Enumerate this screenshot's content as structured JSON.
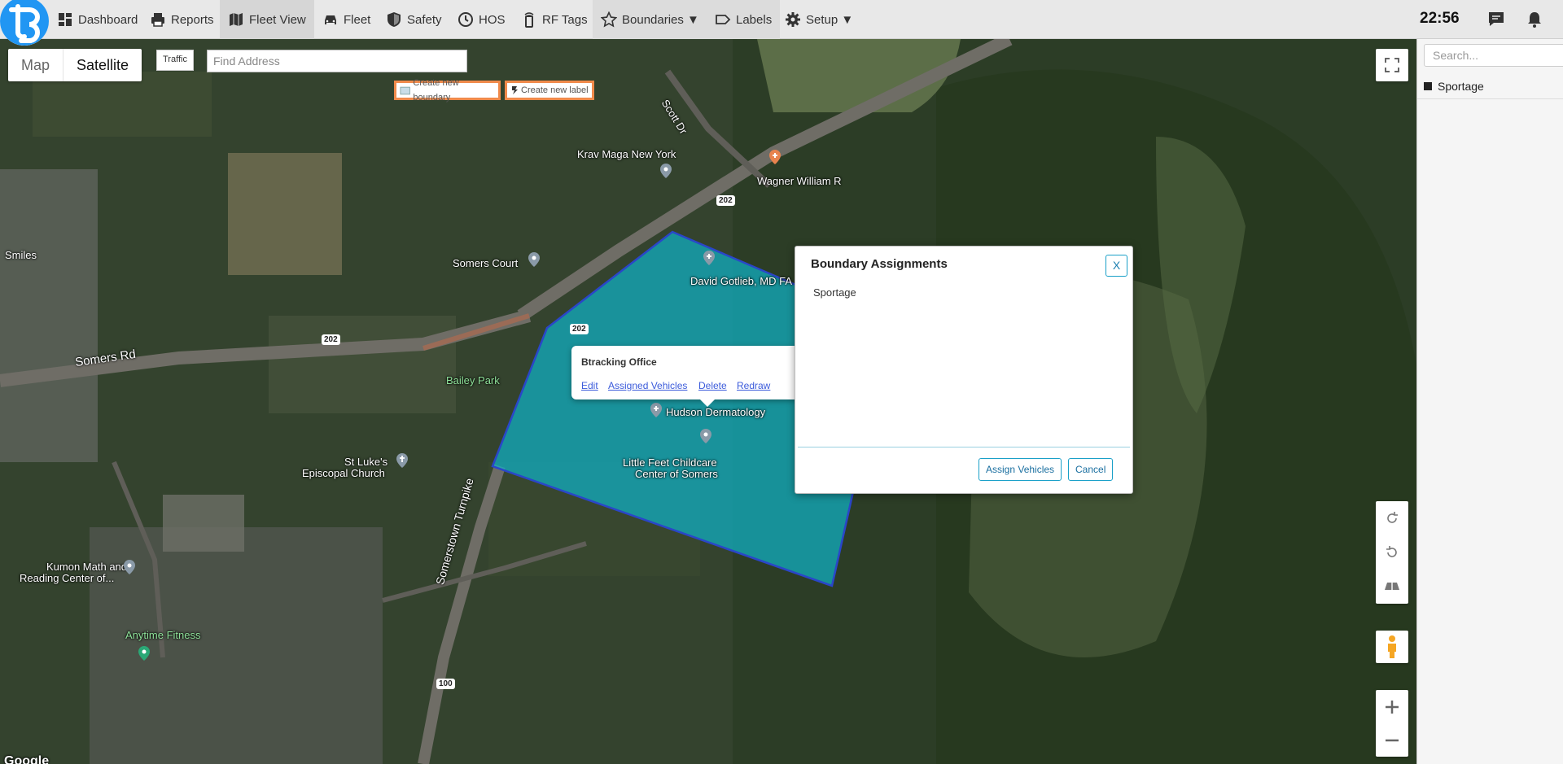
{
  "nav": {
    "items": [
      {
        "label": "Dashboard",
        "icon": "dashboard-icon"
      },
      {
        "label": "Reports",
        "icon": "printer-icon"
      },
      {
        "label": "Fleet View",
        "icon": "map-icon"
      },
      {
        "label": "Fleet",
        "icon": "car-icon"
      },
      {
        "label": "Safety",
        "icon": "shield-icon"
      },
      {
        "label": "HOS",
        "icon": "clock-icon"
      },
      {
        "label": "RF Tags",
        "icon": "rf-tag-icon"
      },
      {
        "label": "Boundaries ▼",
        "icon": "star-icon"
      },
      {
        "label": "Labels",
        "icon": "label-icon"
      },
      {
        "label": "Setup ▼",
        "icon": "gear-icon"
      }
    ],
    "active": "Fleet View",
    "clock": "22:56"
  },
  "map": {
    "type_map": "Map",
    "type_satellite": "Satellite",
    "traffic": "Traffic",
    "address_placeholder": "Find Address",
    "create_boundary": "Create new boundary",
    "create_label": "Create new label",
    "places": {
      "krav_maga": "Krav Maga New York",
      "wagner": "Wagner William R",
      "somers_court": "Somers Court",
      "gotlieb": "David Gotlieb, MD FA",
      "smiles": "Smiles",
      "bailey_park": "Bailey Park",
      "hudson": "Hudson Dermatology",
      "little_feet_1": "Little Feet Childcare",
      "little_feet_2": "Center of Somers",
      "st_lukes_1": "St Luke's",
      "st_lukes_2": "Episcopal Church",
      "kumon_1": "Kumon Math and",
      "kumon_2": "Reading Center of...",
      "anytime": "Anytime Fitness"
    },
    "roads": {
      "scott_dr": "Scott Dr",
      "somers_rd": "Somers Rd",
      "somerstown": "Somerstown Turnpike",
      "route_202": "202",
      "route_100": "100"
    },
    "google": "Google"
  },
  "boundary_popup": {
    "title": "Btracking Office",
    "links": {
      "edit": "Edit",
      "assigned": "Assigned Vehicles",
      "delete": "Delete",
      "redraw": "Redraw"
    }
  },
  "modal": {
    "title": "Boundary Assignments",
    "close": "X",
    "vehicles": [
      "Sportage"
    ],
    "assign_button": "Assign Vehicles",
    "cancel_button": "Cancel"
  },
  "right_panel": {
    "search_placeholder": "Search...",
    "vehicles": [
      "Sportage"
    ]
  }
}
